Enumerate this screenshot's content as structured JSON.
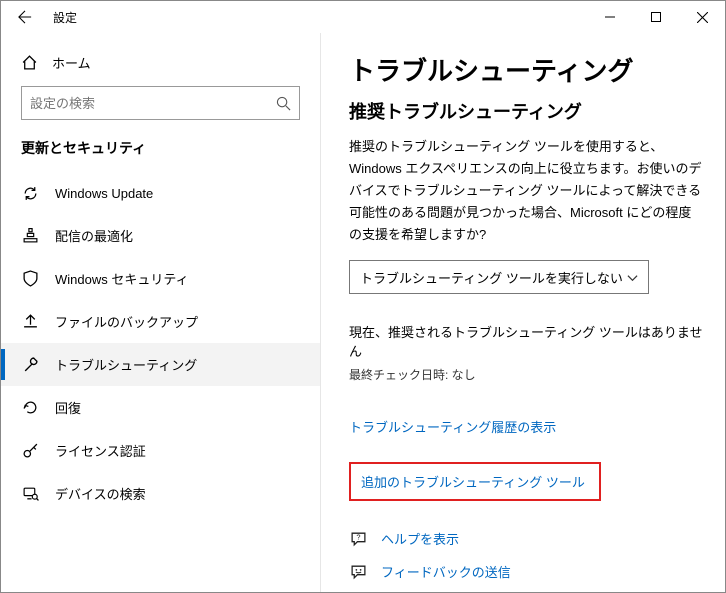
{
  "titlebar": {
    "title": "設定"
  },
  "sidebar": {
    "home_label": "ホーム",
    "search_placeholder": "設定の検索",
    "category": "更新とセキュリティ",
    "items": [
      {
        "label": "Windows Update"
      },
      {
        "label": "配信の最適化"
      },
      {
        "label": "Windows セキュリティ"
      },
      {
        "label": "ファイルのバックアップ"
      },
      {
        "label": "トラブルシューティング"
      },
      {
        "label": "回復"
      },
      {
        "label": "ライセンス認証"
      },
      {
        "label": "デバイスの検索"
      }
    ]
  },
  "main": {
    "heading": "トラブルシューティング",
    "subheading": "推奨トラブルシューティング",
    "description": "推奨のトラブルシューティング ツールを使用すると、Windows エクスペリエンスの向上に役立ちます。お使いのデバイスでトラブルシューティング ツールによって解決できる可能性のある問題が見つかった場合、Microsoft にどの程度の支援を希望しますか?",
    "dropdown_value": "トラブルシューティング ツールを実行しない",
    "status": "現在、推奨されるトラブルシューティング ツールはありません",
    "last_check": "最終チェック日時: なし",
    "history_link": "トラブルシューティング履歴の表示",
    "additional_link": "追加のトラブルシューティング ツール",
    "help_link": "ヘルプを表示",
    "feedback_link": "フィードバックの送信"
  }
}
